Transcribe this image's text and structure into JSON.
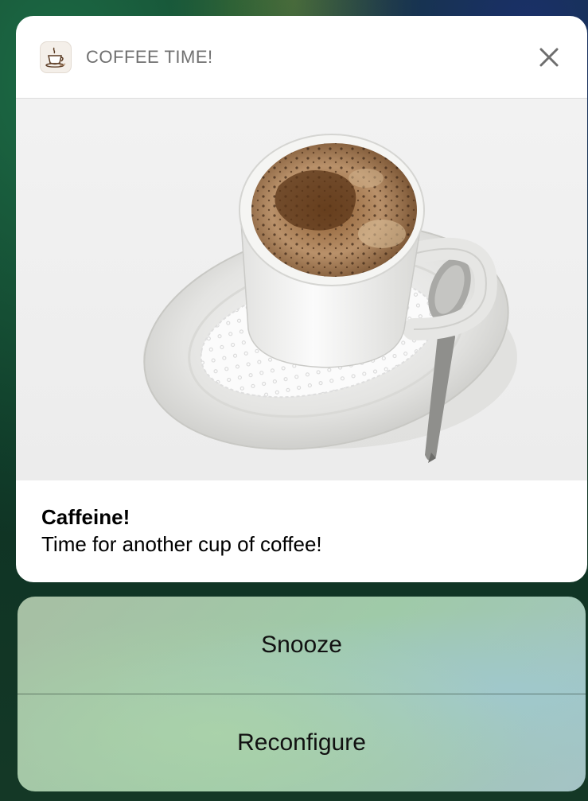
{
  "notification": {
    "app_name": "COFFEE TIME!",
    "app_icon": "coffee-cup-icon",
    "close_icon": "close-icon",
    "image": "coffee-cup-photo",
    "title": "Caffeine!",
    "message": "Time for another cup of coffee!"
  },
  "actions": [
    {
      "label": "Snooze"
    },
    {
      "label": "Reconfigure"
    }
  ],
  "colors": {
    "card_bg": "#ffffff",
    "header_text": "#707070",
    "action_text": "#111111"
  }
}
